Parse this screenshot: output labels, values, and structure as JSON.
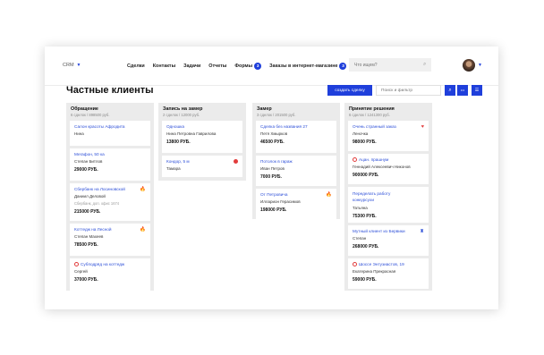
{
  "topbar": {
    "app_label": "CRM",
    "nav": [
      {
        "label": "Сделки"
      },
      {
        "label": "Контакты"
      },
      {
        "label": "Задачи"
      },
      {
        "label": "Отчеты"
      },
      {
        "label": "Формы",
        "badge": "3"
      },
      {
        "label": "Заказы в интернет-магазине",
        "badge": "3"
      }
    ],
    "search_placeholder": "Что ищем?"
  },
  "page": {
    "title": "Частные клиенты",
    "create_button": "создать сделку",
    "filter_placeholder": "Поиск и фильтр",
    "more_icon": "•••"
  },
  "columns": [
    {
      "title": "Обращение",
      "subtitle": "6 сделок / 898500 руб.",
      "cards": [
        {
          "title": "Салон красоты Афродита",
          "name": "Нина",
          "amount": "",
          "icon": "",
          "alert": false
        },
        {
          "title": "Мегафон, 50 ка",
          "name": "Степан Битлов",
          "amount": "29000 РУБ.",
          "icon": "",
          "alert": false
        },
        {
          "title": "Сбербанк на Лосиновской",
          "name": "Даниил Деловой",
          "note": "Сбербанк, доп. офис 1674",
          "amount": "215000 РУБ.",
          "icon": "fire",
          "alert": false
        },
        {
          "title": "Коттедж на Лесной",
          "name": "Степан Махеев",
          "amount": "78500 РУБ.",
          "icon": "fire",
          "alert": false
        },
        {
          "title": "Субподряд на коттедж",
          "name": "Сергей",
          "amount": "37000 РУБ.",
          "icon": "",
          "alert": true
        }
      ]
    },
    {
      "title": "Запись на замер",
      "subtitle": "2 сделок / 12000 руб.",
      "cards": [
        {
          "title": "Одношка",
          "name": "Нина Петровна Гаврилова",
          "amount": "13800 РУБ.",
          "icon": "",
          "alert": false
        },
        {
          "title": "Кондор, 5 м",
          "name": "Тамара",
          "amount": "",
          "icon": "dot",
          "alert": false
        }
      ]
    },
    {
      "title": "Замер",
      "subtitle": "3 сделок / 201500 руб.",
      "cards": [
        {
          "title": "Сделка без названия 27",
          "name": "Петя Хмырков",
          "amount": "46500 РУБ.",
          "icon": "",
          "alert": false
        },
        {
          "title": "Потолок в гараж",
          "name": "Иван Петров",
          "amount": "7000 РУБ.",
          "icon": "",
          "alert": false
        },
        {
          "title": "От Петровича",
          "name": "Илларион Герасимов",
          "amount": "198000 РУБ.",
          "icon": "fire",
          "alert": false
        }
      ]
    },
    {
      "title": "Принятие решения",
      "subtitle": "6 сделок / 1241300 руб.",
      "cards": [
        {
          "title": "Очень странный заказ",
          "name": "Леночка",
          "amount": "98000 РУБ.",
          "icon": "heart",
          "alert": false
        },
        {
          "title": "Ацан. прашнум",
          "name": "Геннадий Алексеевич Никонов",
          "amount": "900000 РУБ.",
          "icon": "",
          "alert": true
        },
        {
          "title": "Переделать работу конкурсухи",
          "name": "Татьяна",
          "amount": "75300 РУБ.",
          "icon": "",
          "alert": false
        },
        {
          "title": "Мутный клиент из Бервики",
          "name": "Степан",
          "amount": "268000 РУБ.",
          "icon": "bottle",
          "alert": false
        },
        {
          "title": "Шоссе Энтузиастов, 19",
          "name": "Екатерина Прекрасная",
          "amount": "59000 РУБ.",
          "icon": "",
          "alert": true
        }
      ]
    }
  ]
}
